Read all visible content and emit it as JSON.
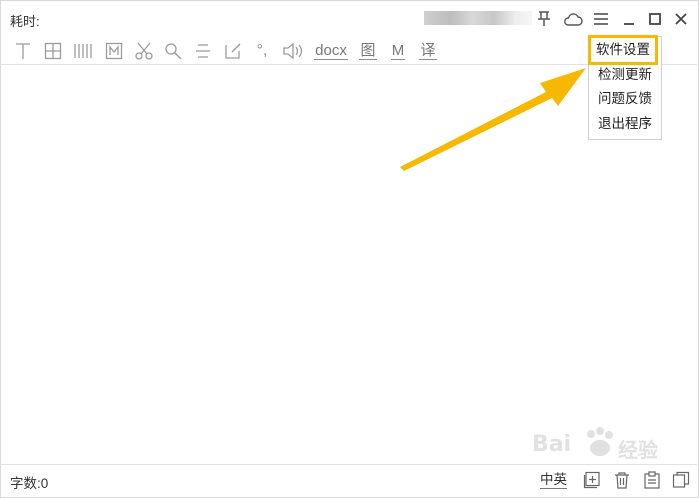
{
  "header": {
    "title": "耗时:"
  },
  "toolbar": {
    "docx_label": "docx",
    "image_label": "图",
    "m_label": "M",
    "translate_label": "译"
  },
  "menu": {
    "items": [
      {
        "label": "软件设置"
      },
      {
        "label": "检测更新"
      },
      {
        "label": "问题反馈"
      },
      {
        "label": "退出程序"
      }
    ]
  },
  "statusbar": {
    "word_count": "字数:0",
    "lang_toggle": "中英"
  },
  "watermark": {
    "brand": "Bai",
    "suffix": "经验"
  },
  "colors": {
    "highlight": "#f6b800",
    "arrow": "#f6b800"
  }
}
